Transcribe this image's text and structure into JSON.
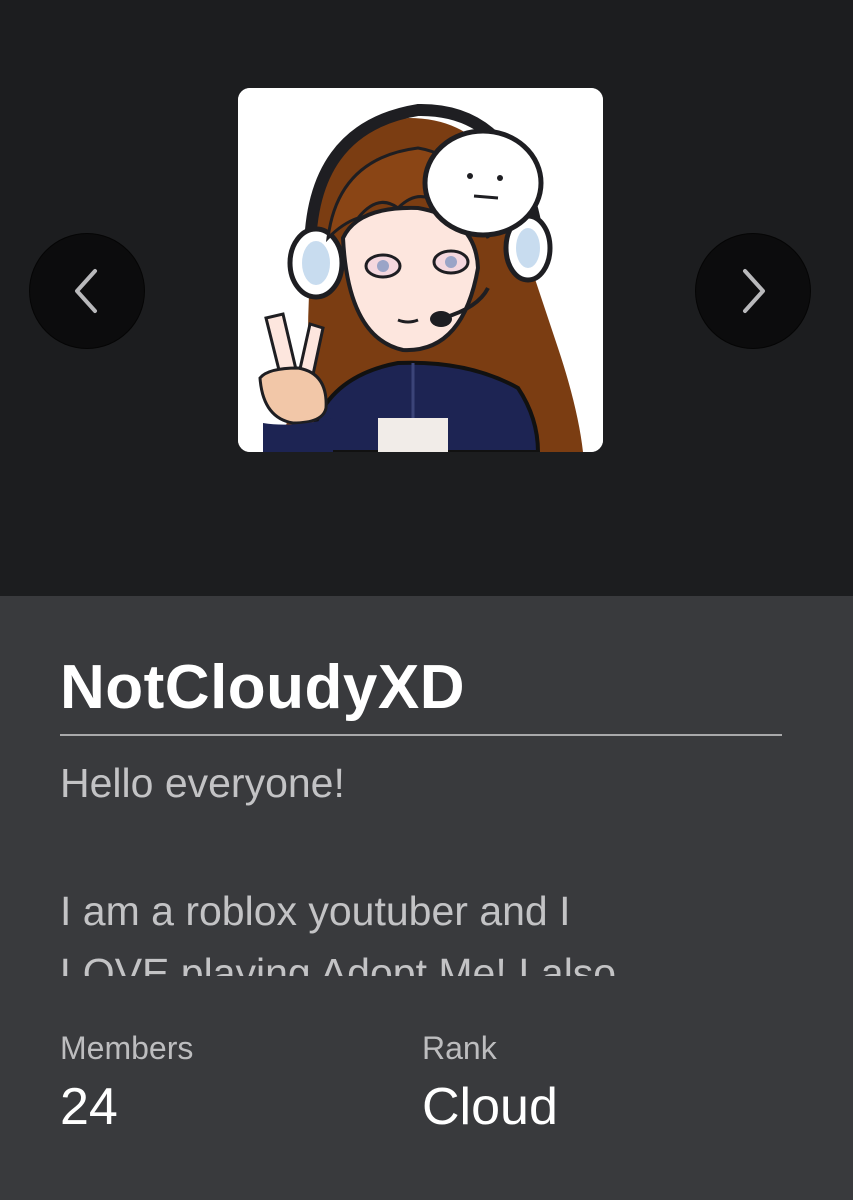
{
  "group": {
    "name": "NotCloudyXD",
    "description_lines": [
      "Hello everyone!",
      "I am a roblox youtuber and I",
      "LOVE playing Adopt Me! I also"
    ]
  },
  "stats": {
    "members_label": "Members",
    "members_value": "24",
    "rank_label": "Rank",
    "rank_value": "Cloud"
  },
  "icons": {
    "prev": "chevron-left-icon",
    "next": "chevron-right-icon"
  },
  "colors": {
    "hero_bg": "#1c1d1f",
    "panel_bg": "#393a3d",
    "title": "#ffffff",
    "body_text": "#c3c3c5"
  }
}
